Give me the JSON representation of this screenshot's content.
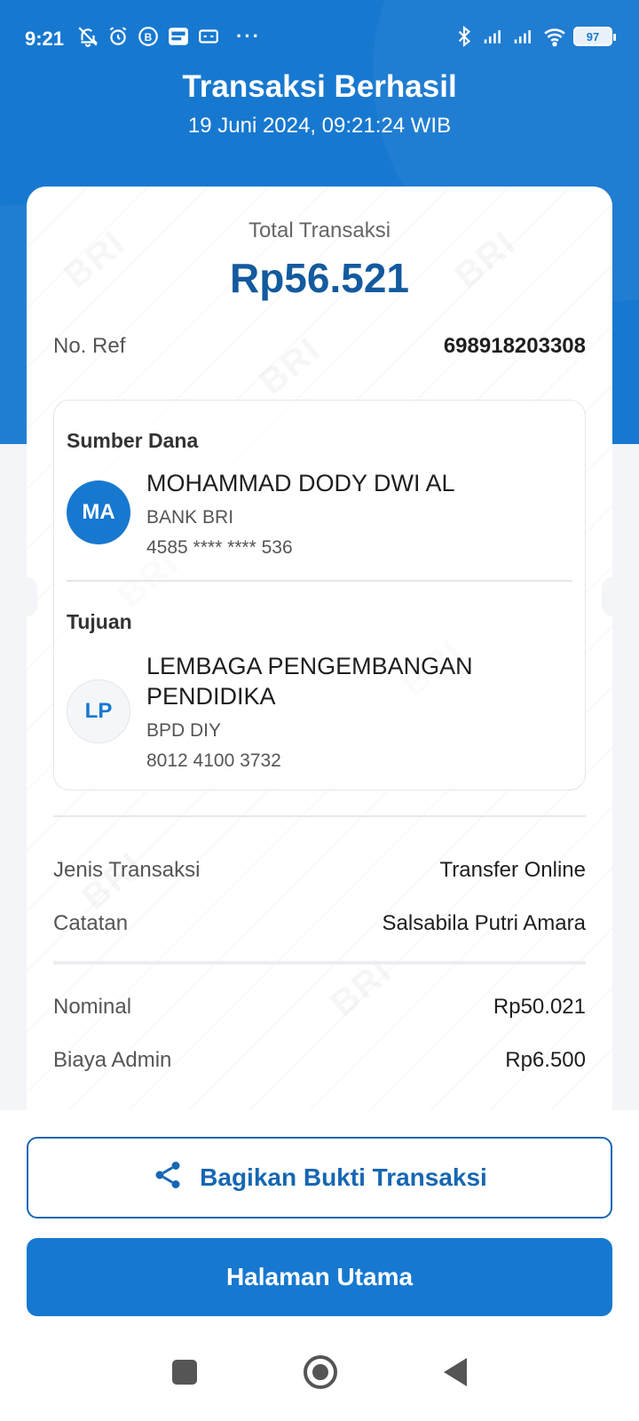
{
  "status_bar": {
    "time": "9:21",
    "battery": "97",
    "more": "···"
  },
  "header": {
    "title": "Transaksi Berhasil",
    "datetime": "19 Juni 2024, 09:21:24 WIB"
  },
  "receipt": {
    "total_label": "Total Transaksi",
    "total_amount": "Rp56.521",
    "ref_label": "No. Ref",
    "ref_value": "698918203308",
    "watermark": "BRI",
    "source": {
      "label": "Sumber Dana",
      "initials": "MA",
      "name": "MOHAMMAD DODY DWI AL",
      "bank": "BANK BRI",
      "account": "4585 **** **** 536"
    },
    "destination": {
      "label": "Tujuan",
      "initials": "LP",
      "name": "LEMBAGA PENGEMBANGAN PENDIDIKA",
      "bank": "BPD DIY",
      "account": "8012 4100 3732"
    },
    "details": {
      "type_label": "Jenis Transaksi",
      "type_value": "Transfer Online",
      "note_label": "Catatan",
      "note_value": "Salsabila Putri Amara",
      "nominal_label": "Nominal",
      "nominal_value": "Rp50.021",
      "fee_label": "Biaya Admin",
      "fee_value": "Rp6.500"
    }
  },
  "actions": {
    "share_label": "Bagikan Bukti Transaksi",
    "home_label": "Halaman Utama"
  },
  "colors": {
    "primary": "#1778d0",
    "amount": "#135a9e"
  }
}
